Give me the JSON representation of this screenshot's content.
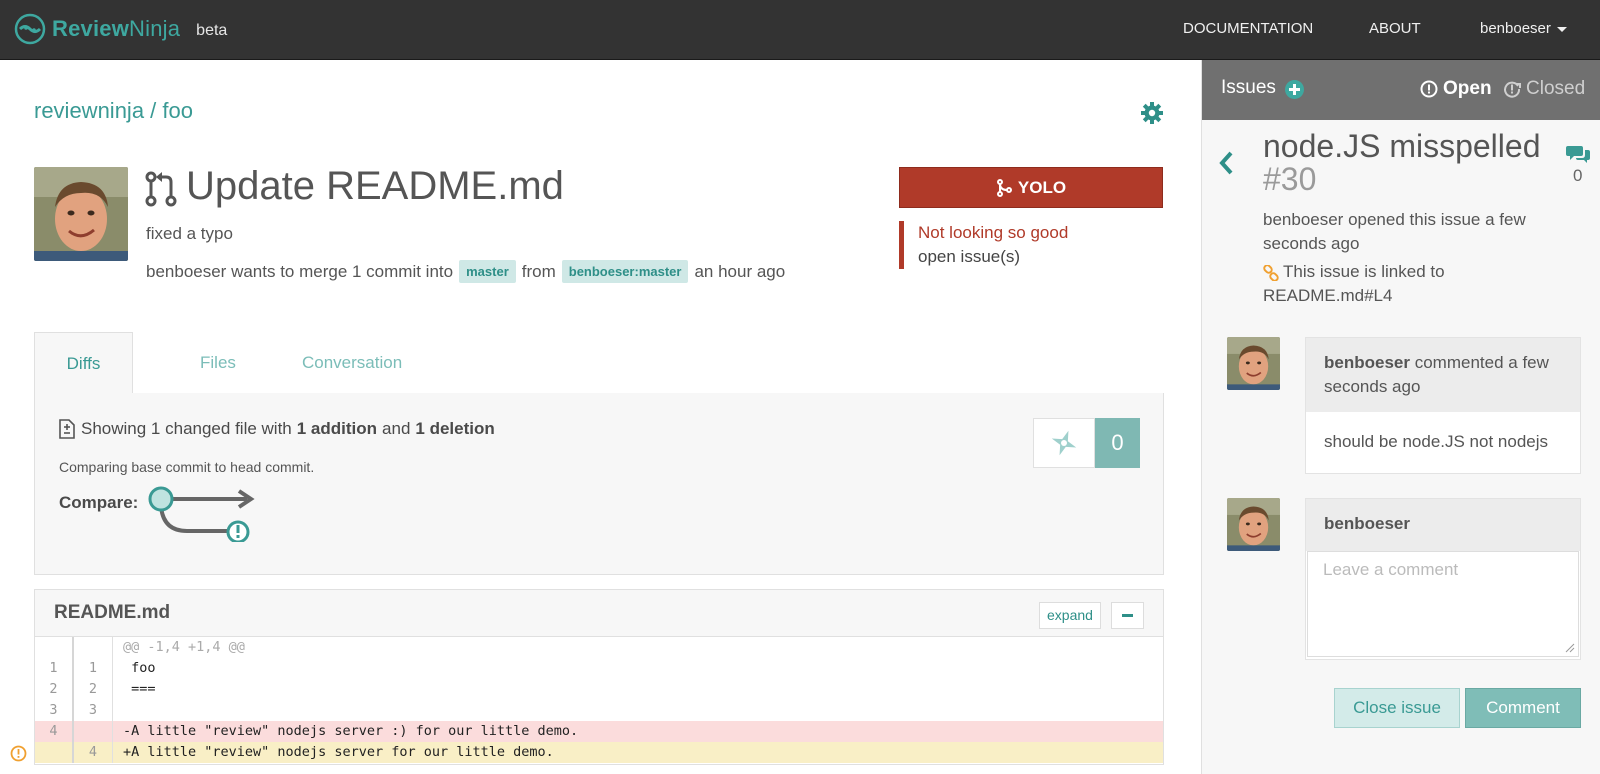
{
  "nav": {
    "brand_part1": "Review",
    "brand_part2": "Ninja",
    "beta": "beta",
    "documentation": "DOCUMENTATION",
    "about": "ABOUT",
    "user": "benboeser"
  },
  "breadcrumb": "reviewninja / foo",
  "pr": {
    "title": "Update README.md",
    "description": "fixed a typo",
    "meta_prefix": "benboeser wants to merge 1 commit into",
    "base_branch": "master",
    "meta_from": "from",
    "head_branch": "benboeser:master",
    "meta_time": "an hour ago",
    "yolo_label": "YOLO",
    "status_title": "Not looking so good",
    "status_sub": "open issue(s)"
  },
  "tabs": [
    "Diffs",
    "Files",
    "Conversation"
  ],
  "summary": {
    "prefix": "Showing 1 changed file with",
    "additions": "1 addition",
    "and": "and",
    "deletions": "1 deletion",
    "compare_text": "Comparing base commit to head commit.",
    "compare_label": "Compare:",
    "star_count": "0"
  },
  "file": {
    "name": "README.md",
    "expand_label": "expand",
    "lines": [
      {
        "type": "hunk",
        "old": "",
        "new": "",
        "code": "@@ -1,4 +1,4 @@"
      },
      {
        "type": "ctx",
        "old": "1",
        "new": "1",
        "code": " foo"
      },
      {
        "type": "ctx",
        "old": "2",
        "new": "2",
        "code": " ==="
      },
      {
        "type": "ctx",
        "old": "3",
        "new": "3",
        "code": ""
      },
      {
        "type": "del",
        "old": "4",
        "new": "",
        "code": "-A little \"review\" nodejs server :) for our little demo."
      },
      {
        "type": "add",
        "old": "",
        "new": "4",
        "code": "+A little \"review\" nodejs server for our little demo."
      }
    ]
  },
  "sidebar": {
    "title": "Issues",
    "open_label": "Open",
    "closed_label": "Closed",
    "issue_title": "node.JS misspelled",
    "issue_number": "#30",
    "comment_count": "0",
    "opened_text": "benboeser opened this issue a few seconds ago",
    "linked_text": "This issue is linked to README.md#L4",
    "comment": {
      "author": "benboeser",
      "action": "commented a few seconds ago",
      "body": "should be node.JS not nodejs"
    },
    "new_comment": {
      "author": "benboeser",
      "placeholder": "Leave a comment"
    },
    "close_button": "Close issue",
    "comment_button": "Comment"
  },
  "colors": {
    "accent": "#3a9a94",
    "danger": "#b03a29",
    "topbar": "#333333"
  }
}
